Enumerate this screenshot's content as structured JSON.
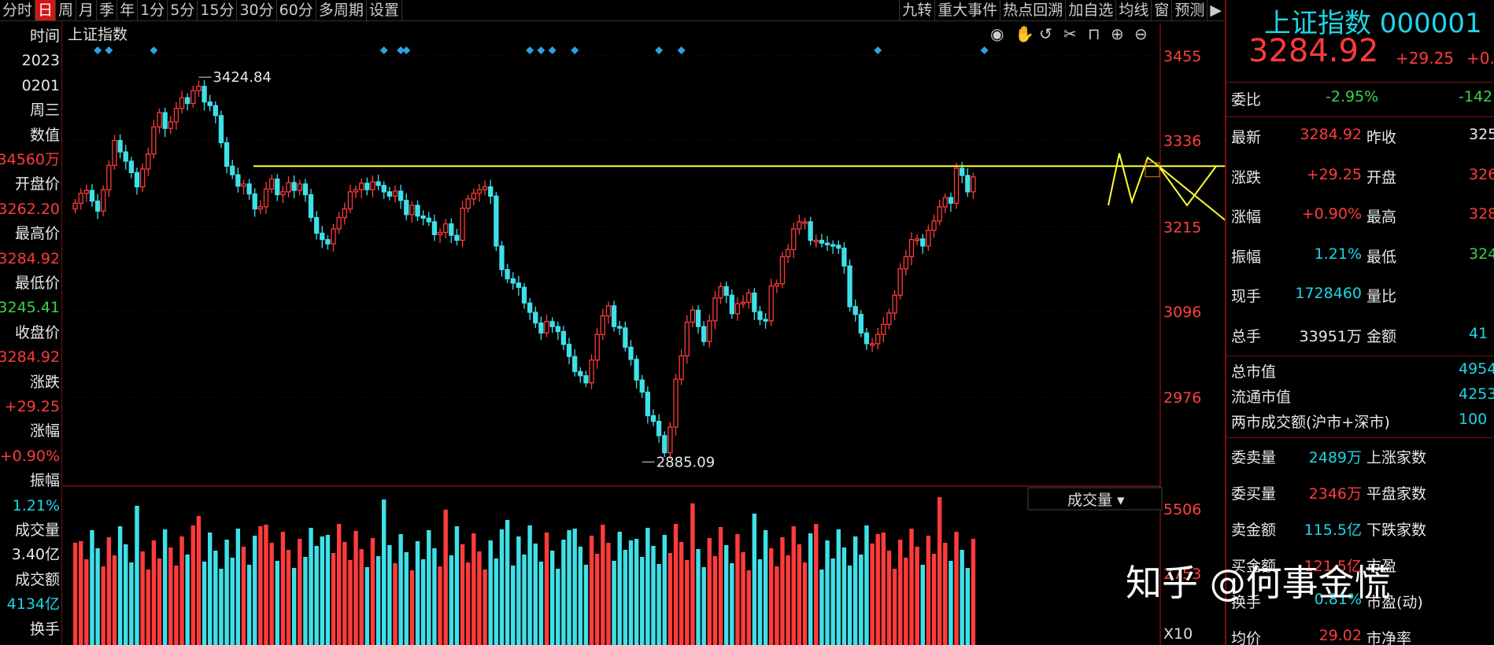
{
  "toolbar": {
    "left_tabs": [
      "分时",
      "日",
      "周",
      "月",
      "季",
      "年",
      "1分",
      "5分",
      "15分",
      "30分",
      "60分",
      "多周期",
      "设置"
    ],
    "active_tab": "日",
    "right_tabs": [
      "九转",
      "重大事件",
      "热点回溯",
      "加自选",
      "均线",
      "窗",
      "预测"
    ]
  },
  "chart_title": "上证指数",
  "volume_selector": "成交量 ▾",
  "volume_axis": [
    "5506",
    "2753",
    "X10"
  ],
  "watermark": "知乎 @何事金慌",
  "left_panel": [
    {
      "text": "时间",
      "color": "white"
    },
    {
      "text": "2023",
      "color": "white"
    },
    {
      "text": "0201",
      "color": "white"
    },
    {
      "text": "周三",
      "color": "white"
    },
    {
      "text": "数值",
      "color": "white"
    },
    {
      "text": "34560万",
      "color": "red"
    },
    {
      "text": "开盘价",
      "color": "white"
    },
    {
      "text": "3262.20",
      "color": "red"
    },
    {
      "text": "最高价",
      "color": "white"
    },
    {
      "text": "3284.92",
      "color": "red"
    },
    {
      "text": "最低价",
      "color": "white"
    },
    {
      "text": "3245.41",
      "color": "green"
    },
    {
      "text": "收盘价",
      "color": "white"
    },
    {
      "text": "3284.92",
      "color": "red"
    },
    {
      "text": "涨跌",
      "color": "white"
    },
    {
      "text": "+29.25",
      "color": "red"
    },
    {
      "text": "涨幅",
      "color": "white"
    },
    {
      "text": "+0.90%",
      "color": "red"
    },
    {
      "text": "振幅",
      "color": "white"
    },
    {
      "text": "1.21%",
      "color": "cyan"
    },
    {
      "text": "成交量",
      "color": "white"
    },
    {
      "text": "3.40亿",
      "color": "white"
    },
    {
      "text": "成交额",
      "color": "white"
    },
    {
      "text": "4134亿",
      "color": "cyan"
    },
    {
      "text": "换手",
      "color": "white"
    }
  ],
  "right_panel": {
    "title": "上证指数 000001",
    "price": "3284.92",
    "change": "+29.25",
    "change_pct": "+0.",
    "weibi_label": "委比",
    "weibi_value": "-2.95%",
    "weibi_extra": "-142",
    "rows": [
      {
        "l1": "最新",
        "v1": "3284.92",
        "c1": "red",
        "l2": "昨收",
        "v2": "325",
        "c2": "white"
      },
      {
        "l1": "涨跌",
        "v1": "+29.25",
        "c1": "red",
        "l2": "开盘",
        "v2": "326",
        "c2": "red"
      },
      {
        "l1": "涨幅",
        "v1": "+0.90%",
        "c1": "red",
        "l2": "最高",
        "v2": "328",
        "c2": "red"
      },
      {
        "l1": "振幅",
        "v1": "1.21%",
        "c1": "cyan",
        "l2": "最低",
        "v2": "324",
        "c2": "green"
      },
      {
        "l1": "现手",
        "v1": "1728460",
        "c1": "cyan",
        "l2": "量比",
        "v2": "",
        "c2": "white"
      },
      {
        "l1": "总手",
        "v1": "33951万",
        "c1": "white",
        "l2": "金额",
        "v2": "41",
        "c2": "cyan"
      }
    ],
    "mktcap": [
      {
        "l": "总市值",
        "v": "4954"
      },
      {
        "l": "流通市值",
        "v": "4253"
      },
      {
        "l": "两市成交额(沪市+深市)",
        "v": "100"
      }
    ],
    "bottom_rows": [
      {
        "l1": "委卖量",
        "v1": "2489万",
        "c1": "cyan",
        "l2": "上涨家数"
      },
      {
        "l1": "委买量",
        "v1": "2346万",
        "c1": "red",
        "l2": "平盘家数"
      },
      {
        "l1": "卖金额",
        "v1": "115.5亿",
        "c1": "cyan",
        "l2": "下跌家数"
      },
      {
        "l1": "买金额",
        "v1": "121.5亿",
        "c1": "red",
        "l2": "市盈"
      },
      {
        "l1": "换手",
        "v1": "0.81%",
        "c1": "cyan",
        "l2": "市盈(动)"
      },
      {
        "l1": "均价",
        "v1": "29.02",
        "c1": "red",
        "l2": "市净率"
      }
    ]
  },
  "colors": {
    "up": "#ff3b3b",
    "down": "#3fe0e8",
    "axis_text": "#ff4040",
    "trend": "#ffff33",
    "grid": "#3a0a0a",
    "background": "#000000"
  },
  "chart_data": {
    "type": "candlestick",
    "title": "上证指数",
    "ylim": [
      2860,
      3500
    ],
    "y_ticks": [
      3455,
      3336,
      3215,
      3096,
      2976
    ],
    "annotations": [
      {
        "label": "3424.84",
        "value": 3424.84,
        "bar_index": 22
      },
      {
        "label": "2885.09",
        "value": 2885.09,
        "bar_index": 101
      }
    ],
    "close": [
      3248,
      3262,
      3266,
      3251,
      3237,
      3267,
      3301,
      3336,
      3320,
      3307,
      3291,
      3271,
      3296,
      3317,
      3355,
      3375,
      3353,
      3362,
      3381,
      3396,
      3388,
      3406,
      3412,
      3390,
      3385,
      3371,
      3333,
      3300,
      3288,
      3272,
      3275,
      3261,
      3240,
      3243,
      3268,
      3282,
      3260,
      3264,
      3277,
      3266,
      3275,
      3260,
      3228,
      3206,
      3197,
      3191,
      3212,
      3228,
      3240,
      3264,
      3267,
      3276,
      3267,
      3278,
      3273,
      3264,
      3258,
      3265,
      3252,
      3232,
      3245,
      3230,
      3227,
      3222,
      3204,
      3207,
      3219,
      3203,
      3196,
      3241,
      3254,
      3262,
      3267,
      3271,
      3258,
      3188,
      3155,
      3142,
      3136,
      3130,
      3108,
      3095,
      3080,
      3066,
      3082,
      3075,
      3068,
      3050,
      3033,
      3012,
      3006,
      2996,
      3028,
      3064,
      3090,
      3104,
      3075,
      3073,
      3046,
      3029,
      3000,
      2983,
      2950,
      2942,
      2922,
      2898,
      2934,
      3001,
      3034,
      3081,
      3098,
      3075,
      3054,
      3083,
      3115,
      3131,
      3119,
      3093,
      3107,
      3109,
      3122,
      3096,
      3085,
      3083,
      3132,
      3135,
      3173,
      3183,
      3212,
      3222,
      3222,
      3196,
      3196,
      3192,
      3190,
      3189,
      3185,
      3160,
      3103,
      3092,
      3066,
      3051,
      3051,
      3064,
      3078,
      3094,
      3119,
      3156,
      3173,
      3197,
      3198,
      3188,
      3210,
      3223,
      3243,
      3256,
      3248,
      3297,
      3287,
      3264,
      3285
    ]
  }
}
